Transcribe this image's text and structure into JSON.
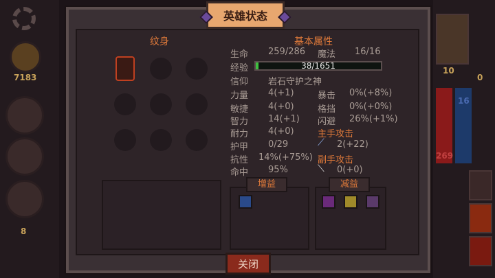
{
  "hud": {
    "gold": "7183",
    "left_count": "8",
    "right_level": "10",
    "right_top_num": "0",
    "right_blue": "16",
    "right_red": "269"
  },
  "panel": {
    "title": "英雄状态",
    "tattoo_label": "纹身",
    "base_label": "基本属性",
    "close_label": "关闭"
  },
  "stats": {
    "hp_label": "生命",
    "hp_value": "259/286",
    "mp_label": "魔法",
    "mp_value": "16/16",
    "xp_label": "经验",
    "xp_value": "38/1651",
    "xp_fraction": 0.023,
    "faith_label": "信仰",
    "faith_value": "岩石守护之神",
    "str_label": "力量",
    "str_value": "4(+1)",
    "crit_label": "暴击",
    "crit_value": "0%(+8%)",
    "agi_label": "敏捷",
    "agi_value": "4(+0)",
    "block_label": "格挡",
    "block_value": "0%(+0%)",
    "int_label": "智力",
    "int_value": "14(+1)",
    "dodge_label": "闪避",
    "dodge_value": "26%(+1%)",
    "end_label": "耐力",
    "end_value": "4(+0)",
    "armor_label": "护甲",
    "armor_value": "0/29",
    "resist_label": "抗性",
    "resist_value": "14%(+75%)",
    "hit_label": "命中",
    "hit_value": "95%",
    "main_hand_label": "主手攻击",
    "main_hand_value": "2(+22)",
    "off_hand_label": "副手攻击",
    "off_hand_value": "0(+0)"
  },
  "buffs": {
    "positive_label": "增益",
    "negative_label": "减益",
    "positive_icons": [
      "blue-shield-icon"
    ],
    "negative_icons": [
      "purple-skull-icon",
      "yellow-skull-icon",
      "purple-mask-icon"
    ]
  }
}
